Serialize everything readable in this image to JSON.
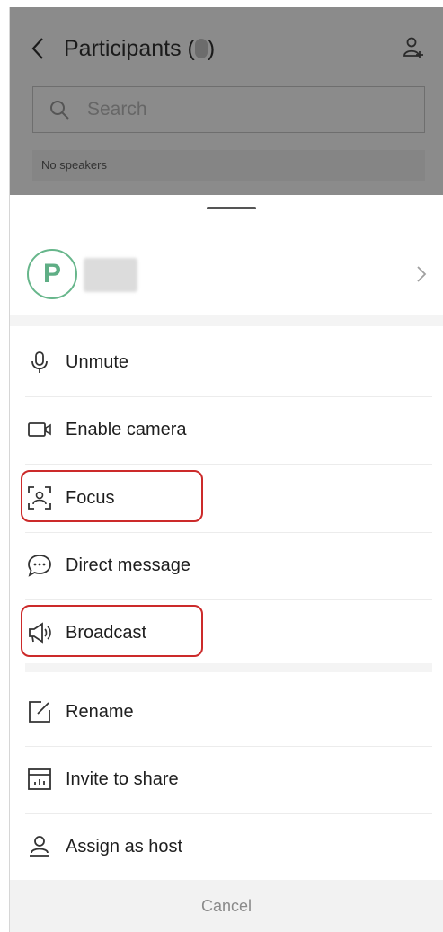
{
  "header": {
    "title": "Participants (",
    "title_suffix": ")",
    "search_placeholder": "Search",
    "speakers_text": "No speakers"
  },
  "sheet": {
    "avatar_letter": "P",
    "user_name": "",
    "menu": [
      {
        "label": "Unmute",
        "icon": "microphone-icon"
      },
      {
        "label": "Enable camera",
        "icon": "camera-icon"
      },
      {
        "label": "Focus",
        "icon": "focus-icon",
        "highlighted": true
      },
      {
        "label": "Direct message",
        "icon": "chat-bubble-icon"
      },
      {
        "label": "Broadcast",
        "icon": "megaphone-icon",
        "highlighted": true
      },
      {
        "label": "Rename",
        "icon": "edit-icon"
      },
      {
        "label": "Invite to share",
        "icon": "share-screen-icon"
      },
      {
        "label": "Assign as host",
        "icon": "host-icon"
      }
    ],
    "cancel_label": "Cancel"
  },
  "colors": {
    "dim_overlay": "#8b8b8b",
    "avatar_green": "#67b68b",
    "highlight_red": "#cc2a2a"
  }
}
